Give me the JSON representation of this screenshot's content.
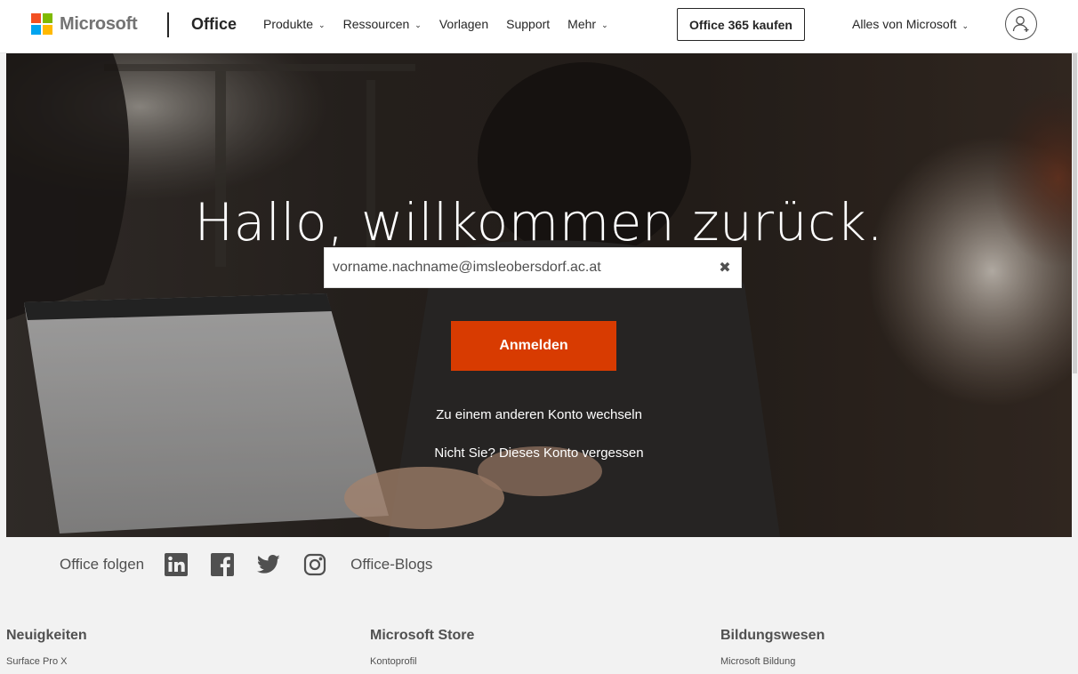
{
  "header": {
    "brand": "Microsoft",
    "product": "Office",
    "nav": [
      {
        "label": "Produkte",
        "dropdown": true
      },
      {
        "label": "Ressourcen",
        "dropdown": true
      },
      {
        "label": "Vorlagen",
        "dropdown": false
      },
      {
        "label": "Support",
        "dropdown": false
      },
      {
        "label": "Mehr",
        "dropdown": true
      }
    ],
    "buy_label": "Office 365 kaufen",
    "all_microsoft": "Alles von Microsoft",
    "icons": {
      "avatar": "account-add-icon",
      "chevron": "chevron-down-icon"
    }
  },
  "hero": {
    "title": "Hallo, willkommen zurück.",
    "email_value": "vorname.nachname@imsleobersdorf.ac.at",
    "clear_icon": "close-icon",
    "signin_label": "Anmelden",
    "switch_account": "Zu einem anderen Konto wechseln",
    "not_you": "Nicht Sie?",
    "forget_account": "Dieses Konto vergessen"
  },
  "follow": {
    "label": "Office folgen",
    "networks": [
      "linkedin-icon",
      "facebook-icon",
      "twitter-icon",
      "instagram-icon"
    ],
    "blogs": "Office-Blogs"
  },
  "footer": {
    "columns": [
      {
        "heading": "Neuigkeiten",
        "links": [
          "Surface Pro X"
        ]
      },
      {
        "heading": "Microsoft Store",
        "links": [
          "Kontoprofil"
        ]
      },
      {
        "heading": "Bildungswesen",
        "links": [
          "Microsoft Bildung"
        ]
      }
    ]
  },
  "colors": {
    "accent": "#d83b01",
    "ms_red": "#f25022",
    "ms_green": "#7fba00",
    "ms_blue": "#00a4ef",
    "ms_yellow": "#ffb900"
  }
}
